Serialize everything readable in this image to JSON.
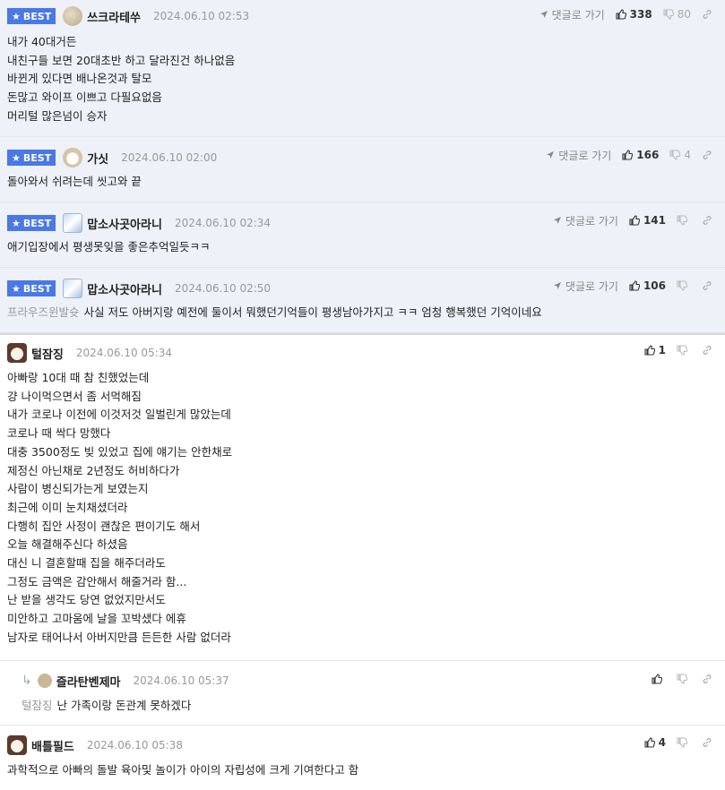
{
  "labels": {
    "best": "BEST",
    "reply_link": "댓글로 가기"
  },
  "comments": [
    {
      "name": "쓰크라테쑤",
      "date": "2024.06.10 02:53",
      "likes": "338",
      "dislikes": "80",
      "lines": [
        "내가 40대거든",
        "내친구들 보면 20대초반 하고 달라진건 하나없음",
        "바뀐게 있다면 배나온것과 탈모",
        "돈많고 와이프 이쁘고 다필요없음",
        "머리털 많은넘이 승자"
      ]
    },
    {
      "name": "가싯",
      "date": "2024.06.10 02:00",
      "likes": "166",
      "dislikes": "4",
      "lines": [
        "돌아와서 쉬려는데 씻고와 끝"
      ]
    },
    {
      "name": "맙소사곳아라니",
      "date": "2024.06.10 02:34",
      "likes": "141",
      "dislikes": "",
      "lines": [
        "애기입장에서 평생못잊을 좋은추억일듯ㅋㅋ"
      ]
    },
    {
      "name": "맙소사곳아라니",
      "date": "2024.06.10 02:50",
      "likes": "106",
      "dislikes": "",
      "mention": "프라우즈윈발슛",
      "lines": [
        "사실 저도 아버지랑 예전에 둘이서 뭐했던기억들이 평생남아가지고 ㅋㅋ 엄청 행복했던 기억이네요"
      ]
    },
    {
      "name": "털잠징",
      "date": "2024.06.10 05:34",
      "likes": "1",
      "dislikes": "",
      "lines": [
        "아빠랑 10대 때 참 친했었는데",
        "걍 나이먹으면서 좀 서먹해짐",
        "내가 코로나 이전에 이것저것 일벌린게 많았는데",
        "코로나 때 싹다 망했다",
        "대충 3500정도 빚 있었고 집에 얘기는 안한채로",
        "제정신 아닌채로 2년정도 허비하다가",
        "사람이 병신되가는게 보였는지",
        "최근에 이미 눈치채셨더라",
        "다행히 집안 사정이 괜찮은 편이기도 해서",
        "오늘 해결해주신다 하셨음",
        "대신 니 결혼할때 집을 해주더라도",
        "그정도 금액은 감안해서 해줄거라 함...",
        "난 받을 생각도 당연 없었지만서도",
        "미안하고 고마움에 날을 꼬박샜다 에휴",
        "남자로 태어나서 아버지만큼 든든한 사람 없더라"
      ]
    },
    {
      "name": "즐라탄벤제마",
      "date": "2024.06.10 05:37",
      "likes": "",
      "dislikes": "",
      "mention": "털잠징",
      "lines": [
        "난 가족이랑 돈관계 못하겠다"
      ]
    },
    {
      "name": "배틀필드",
      "date": "2024.06.10 05:38",
      "likes": "4",
      "dislikes": "",
      "lines": [
        "과학적으로 아빠의 돌발 육아및 놀이가 아이의 자립성에 크게 기여한다고 함"
      ]
    }
  ]
}
